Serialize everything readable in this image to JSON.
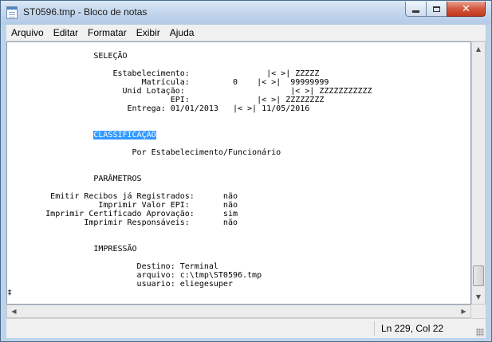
{
  "window": {
    "title": "ST0596.tmp - Bloco de notas",
    "controls": {
      "minimize": "minimize",
      "maximize": "maximize",
      "close": "✕"
    }
  },
  "menu": [
    {
      "label": "Arquivo"
    },
    {
      "label": "Editar"
    },
    {
      "label": "Formatar"
    },
    {
      "label": "Exibir"
    },
    {
      "label": "Ajuda"
    }
  ],
  "editor": {
    "lines": [
      {
        "text": "                  SELEÇÃO"
      },
      {
        "text": ""
      },
      {
        "text": "                      Estabelecimento:                |< >| ZZZZZ"
      },
      {
        "text": "                            Matrícula:         0    |< >|  99999999"
      },
      {
        "text": "                        Unid Lotação:                      |< >| ZZZZZZZZZZZ"
      },
      {
        "text": "                                  EPI:              |< >| ZZZZZZZZ"
      },
      {
        "text": "                         Entrega: 01/01/2013   |< >| 11/05/2016"
      },
      {
        "text": ""
      },
      {
        "text": ""
      },
      {
        "text": "                  ",
        "selected": "CLASSIFICAÇÃO"
      },
      {
        "text": ""
      },
      {
        "text": "                          Por Estabelecimento/Funcionário"
      },
      {
        "text": ""
      },
      {
        "text": ""
      },
      {
        "text": "                  PARÂMETROS"
      },
      {
        "text": ""
      },
      {
        "text": "         Emitir Recibos já Registrados:      não"
      },
      {
        "text": "                   Imprimir Valor EPI:       não"
      },
      {
        "text": "        Imprimir Certificado Aprovação:      sim"
      },
      {
        "text": "                Imprimir Responsáveis:       não"
      },
      {
        "text": ""
      },
      {
        "text": ""
      },
      {
        "text": "                  IMPRESSÃO"
      },
      {
        "text": ""
      },
      {
        "text": "                           Destino: Terminal"
      },
      {
        "text": "                           arquivo: c:\\tmp\\ST0596.tmp"
      },
      {
        "text": "                           usuario: eliegesuper"
      },
      {
        "text": "‡"
      }
    ]
  },
  "status": {
    "position": "Ln 229, Col 22"
  }
}
